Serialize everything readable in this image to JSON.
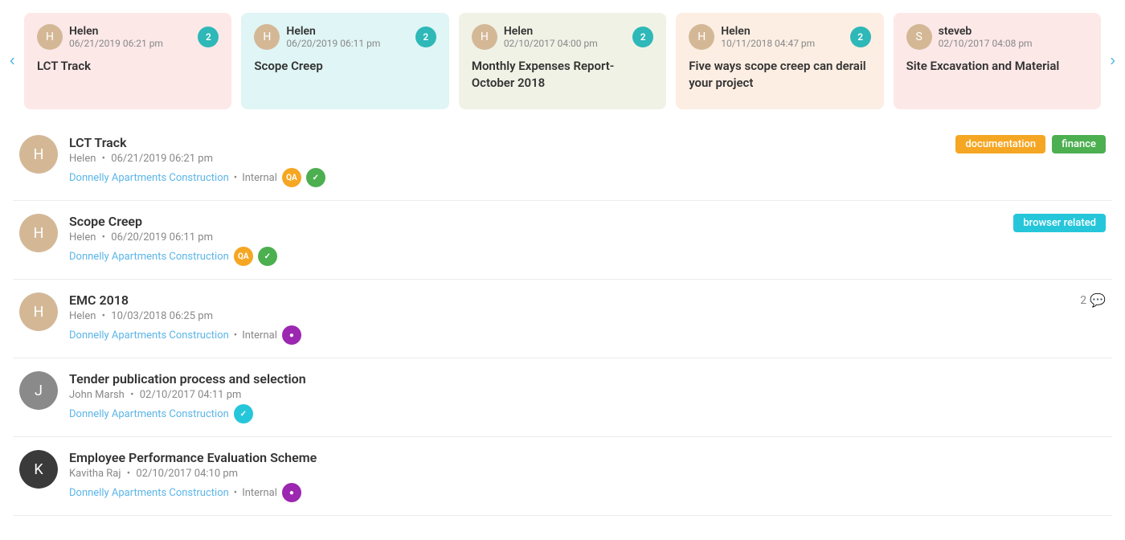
{
  "carousel": {
    "cards": [
      {
        "id": "lct-track",
        "background": "card-pink",
        "user": "Helen",
        "date": "06/21/2019 06:21 pm",
        "title": "LCT Track",
        "badge": "2",
        "badgeColor": "#2eb8b8"
      },
      {
        "id": "scope-creep",
        "background": "card-teal",
        "user": "Helen",
        "date": "06/20/2019 06:11 pm",
        "title": "Scope Creep",
        "badge": "2",
        "badgeColor": "#2eb8b8"
      },
      {
        "id": "monthly-expenses",
        "background": "card-olive",
        "user": "Helen",
        "date": "02/10/2017 04:00 pm",
        "title": "Monthly Expenses Report- October 2018",
        "badge": "2",
        "badgeColor": "#2eb8b8"
      },
      {
        "id": "five-ways",
        "background": "card-peach",
        "user": "Helen",
        "date": "10/11/2018 04:47 pm",
        "title": "Five ways scope creep can derail your project",
        "badge": "2",
        "badgeColor": "#2eb8b8"
      },
      {
        "id": "site-excavation",
        "background": "card-pink",
        "user": "steveb",
        "date": "02/10/2017 04:08 pm",
        "title": "Site Excavation and Material",
        "badge": "",
        "badgeColor": ""
      }
    ],
    "nav_left": "‹",
    "nav_right": "›"
  },
  "list": {
    "items": [
      {
        "id": "lct-track-item",
        "avatar_color": "av-helen",
        "avatar_initials": "H",
        "title": "LCT Track",
        "author": "Helen",
        "date": "06/21/2019 06:21 pm",
        "project_link": "Donnelly Apartments Construction",
        "has_internal": true,
        "internal_label": "Internal",
        "avatars": [
          {
            "initials": "QA",
            "color": "avatar-orange"
          },
          {
            "initials": "✓",
            "color": "avatar-green"
          }
        ],
        "tags": [
          {
            "label": "documentation",
            "color": "tag-orange"
          },
          {
            "label": "finance",
            "color": "tag-green"
          }
        ],
        "comment_count": null
      },
      {
        "id": "scope-creep-item",
        "avatar_color": "av-helen",
        "avatar_initials": "H",
        "title": "Scope Creep",
        "author": "Helen",
        "date": "06/20/2019 06:11 pm",
        "project_link": "Donnelly Apartments Construction",
        "has_internal": false,
        "internal_label": "",
        "avatars": [
          {
            "initials": "QA",
            "color": "avatar-orange"
          },
          {
            "initials": "✓",
            "color": "avatar-green"
          }
        ],
        "tags": [
          {
            "label": "browser related",
            "color": "tag-teal"
          }
        ],
        "comment_count": null
      },
      {
        "id": "emc-2018-item",
        "avatar_color": "av-helen",
        "avatar_initials": "H",
        "title": "EMC 2018",
        "author": "Helen",
        "date": "10/03/2018 06:25 pm",
        "project_link": "Donnelly Apartments Construction",
        "has_internal": true,
        "internal_label": "Internal",
        "avatars": [
          {
            "initials": "●",
            "color": "avatar-purple"
          }
        ],
        "tags": [],
        "comment_count": "2"
      },
      {
        "id": "tender-item",
        "avatar_color": "av-john",
        "avatar_initials": "J",
        "title": "Tender publication process and selection",
        "author": "John Marsh",
        "date": "02/10/2017 04:11 pm",
        "project_link": "Donnelly Apartments Construction",
        "has_internal": false,
        "internal_label": "",
        "avatars": [
          {
            "initials": "✓",
            "color": "avatar-teal"
          }
        ],
        "tags": [],
        "comment_count": null
      },
      {
        "id": "employee-eval-item",
        "avatar_color": "av-kavitha",
        "avatar_initials": "K",
        "title": "Employee Performance Evaluation Scheme",
        "author": "Kavitha Raj",
        "date": "02/10/2017 04:10 pm",
        "project_link": "Donnelly Apartments Construction",
        "has_internal": true,
        "internal_label": "Internal",
        "avatars": [
          {
            "initials": "●",
            "color": "avatar-purple"
          }
        ],
        "tags": [],
        "comment_count": null
      }
    ]
  }
}
